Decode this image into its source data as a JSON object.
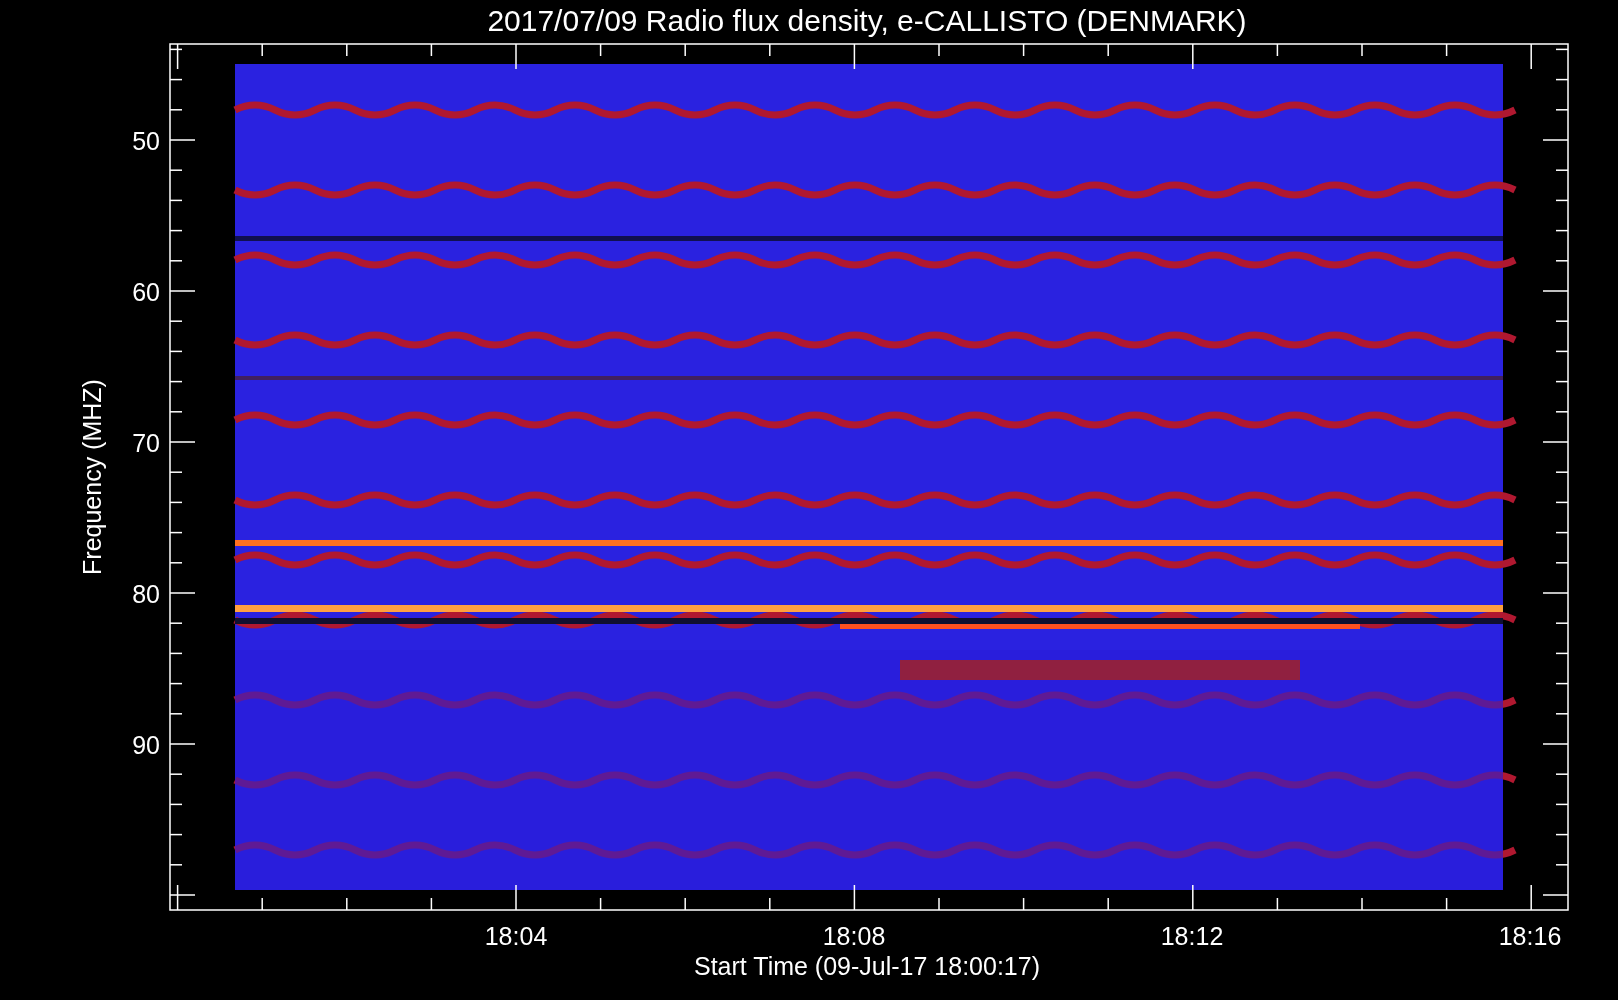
{
  "title": "2017/07/09  Radio flux density, e-CALLISTO (DENMARK)",
  "y_axis": {
    "label": "Frequency (MHZ)",
    "ticks": [
      "50",
      "60",
      "70",
      "80",
      "90"
    ]
  },
  "x_axis": {
    "label": "Start Time (09-Jul-17 18:00:17)",
    "ticks": [
      "18:04",
      "18:08",
      "18:12",
      "18:16"
    ]
  }
}
